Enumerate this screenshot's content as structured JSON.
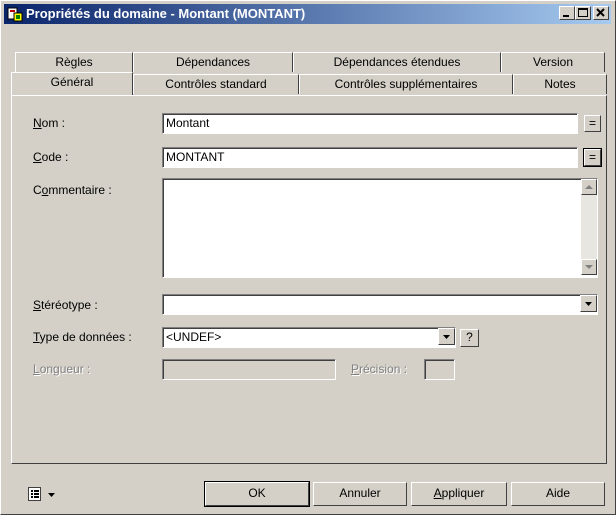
{
  "window": {
    "title": "Propriétés du domaine - Montant (MONTANT)",
    "icon": "domain-properties-icon",
    "controls": [
      "minimize-icon",
      "maximize-icon",
      "close-icon"
    ]
  },
  "tabs": {
    "row_back": [
      {
        "label": "Règles"
      },
      {
        "label": "Dépendances"
      },
      {
        "label": "Dépendances étendues"
      },
      {
        "label": "Version"
      }
    ],
    "row_front": [
      {
        "label": "Général",
        "active": true
      },
      {
        "label": "Contrôles standard"
      },
      {
        "label": "Contrôles supplémentaires"
      },
      {
        "label": "Notes"
      }
    ]
  },
  "form": {
    "nom": {
      "label_mnemonic": "N",
      "label_rest": "om :",
      "value": "Montant",
      "btn": "="
    },
    "code": {
      "label_mnemonic": "C",
      "label_rest": "ode :",
      "value": "MONTANT",
      "btn": "="
    },
    "commentaire": {
      "label_pre": "C",
      "label_mnemonic": "o",
      "label_rest": "mmentaire :",
      "value": ""
    },
    "stereotype": {
      "label_mnemonic": "S",
      "label_rest": "téréotype :",
      "value": ""
    },
    "type_donnees": {
      "label_mnemonic": "T",
      "label_rest": "ype de données :",
      "value": "<UNDEF>",
      "help_btn": "?"
    },
    "longueur": {
      "label_mnemonic": "L",
      "label_rest": "ongueur :",
      "value": ""
    },
    "precision": {
      "label_mnemonic": "P",
      "label_rest": "récision :",
      "value": ""
    }
  },
  "footer": {
    "menu_icon": "properties-list-icon",
    "ok": "OK",
    "annuler": "Annuler",
    "appliquer_mnemonic": "A",
    "appliquer_rest": "ppliquer",
    "aide": "Aide"
  },
  "colors": {
    "titlebar_start": "#0a246a",
    "titlebar_end": "#a6caf0",
    "face": "#d4d0c8"
  }
}
